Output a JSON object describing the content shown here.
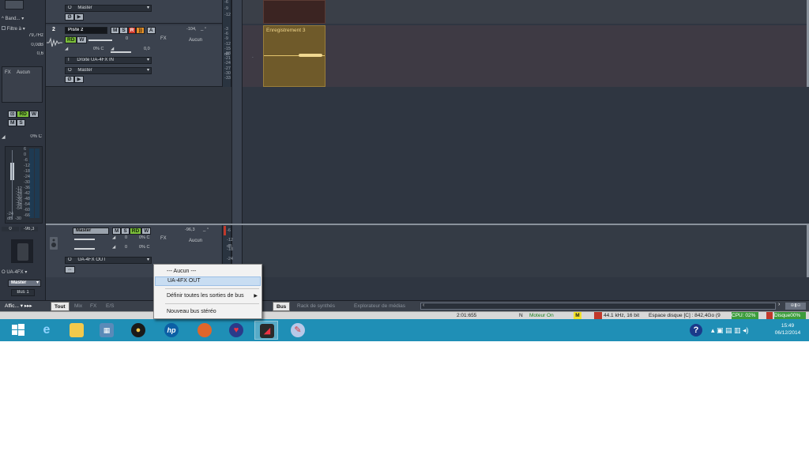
{
  "inspector": {
    "preset": "Band...",
    "filter_label": "Filtre à",
    "freq": "79,7Hz",
    "gain": "0,0dB",
    "q": "0,6",
    "fx_label": "FX",
    "fx_value": "Aucun",
    "pan": "0% C",
    "meter_value": "0",
    "meter_peak": "-96,3",
    "ticks": [
      "6",
      "0",
      "-6",
      "-12",
      "-18",
      "-24",
      "-30",
      "-36",
      "-42",
      "-48",
      "-54",
      "-60",
      "-66"
    ],
    "side_ticks": [
      "-12",
      "-18",
      "-24",
      "-30",
      "-36",
      "-42",
      "-48",
      "-54"
    ],
    "scale_low": [
      "-24",
      "-30"
    ],
    "db_label": "dB",
    "output": "UA-4FX",
    "bus_select": "Master",
    "bus_label": "Bus 1",
    "display_menu": "Affic..."
  },
  "track1": {
    "out_label": "Master",
    "meter_ticks": [
      "-6",
      "-9",
      "-12"
    ]
  },
  "track2": {
    "number": "2",
    "name": "Piste 2",
    "volume": "0",
    "pan": "0% C",
    "pan_value": "0,0",
    "input": "Droite UA-4FX IN",
    "output": "Master",
    "fx_label": "FX",
    "fx_value": "Aucun",
    "peak": "-104,",
    "meter_ticks": [
      "-3",
      "-6",
      "-9",
      "-12",
      "-15",
      "-18",
      "-21",
      "-24",
      "-27",
      "-30",
      "-33"
    ],
    "db": "dB"
  },
  "buttons": {
    "m": "M",
    "s": "S",
    "r": "R",
    "rd": "RD",
    "w": "W",
    "a": "A",
    "i": "I",
    "o": "O"
  },
  "clip": {
    "name": "Enregistrement 3"
  },
  "master": {
    "name": "Master",
    "vol1": "0",
    "pan1": "0% C",
    "vol2": "0",
    "pan2": "0% C",
    "output": "UA-4FX OUT",
    "fx_label": "FX",
    "fx_value": "Aucun",
    "peak": "-96,3",
    "ticks": [
      "-6",
      "-12",
      "-18",
      "-24"
    ],
    "db": "dB"
  },
  "context_menu": {
    "items": [
      "--- Aucun ---",
      "UA-4FX OUT",
      "Définir toutes les sorties de bus",
      "Nouveau bus stéréo"
    ]
  },
  "tabs": {
    "left": [
      "Tout",
      "Mix",
      "FX",
      "E/S"
    ],
    "right": [
      "Bus",
      "Rack de synthés",
      "Explorateur de médias"
    ]
  },
  "status": {
    "time": "2:01:655",
    "n": "N",
    "engine": "Moteur On",
    "m": "M",
    "format": "44.1 kHz, 16 bit",
    "disk_space": "Espace disque [C] : 842,4Go (9",
    "cpu": "CPU: 02%",
    "disk": "Disque00%"
  },
  "taskbar": {
    "time": "15:49",
    "date": "06/12/2014",
    "apps": [
      "windows-logo",
      "ie",
      "explorer",
      "calculator",
      "media",
      "hp",
      "firefox",
      "heart-app",
      "sonar",
      "paint"
    ]
  },
  "colors": {
    "accent_green": "#7cbf3a",
    "record_red": "#d33a2a",
    "clip_gold": "#6f5a2a",
    "taskbar": "#1f8fb6"
  }
}
